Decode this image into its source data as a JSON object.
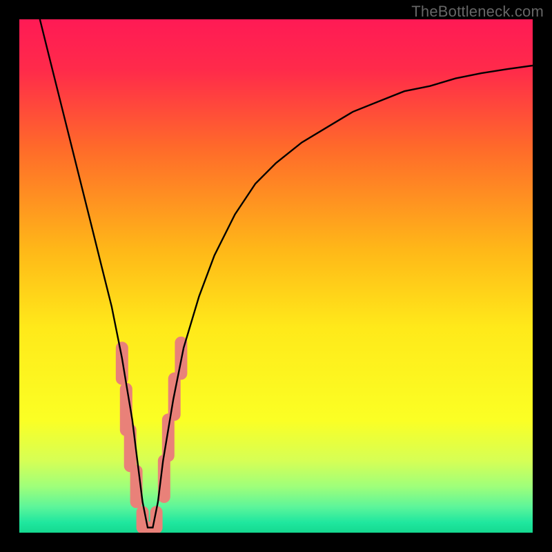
{
  "watermark": "TheBottleneck.com",
  "chart_data": {
    "type": "line",
    "title": "",
    "xlabel": "",
    "ylabel": "",
    "xlim": [
      0,
      100
    ],
    "ylim": [
      0,
      100
    ],
    "gradient_stops": [
      {
        "offset": 0.0,
        "color": "#ff1a55"
      },
      {
        "offset": 0.1,
        "color": "#ff2b4a"
      },
      {
        "offset": 0.25,
        "color": "#ff6a2a"
      },
      {
        "offset": 0.45,
        "color": "#ffb818"
      },
      {
        "offset": 0.6,
        "color": "#ffe91a"
      },
      {
        "offset": 0.78,
        "color": "#fbff24"
      },
      {
        "offset": 0.86,
        "color": "#d6ff55"
      },
      {
        "offset": 0.91,
        "color": "#9fff7a"
      },
      {
        "offset": 0.95,
        "color": "#5cf59a"
      },
      {
        "offset": 0.98,
        "color": "#1fe79f"
      },
      {
        "offset": 1.0,
        "color": "#15d98f"
      }
    ],
    "series": [
      {
        "name": "bottleneck-curve",
        "x": [
          4,
          6,
          8,
          10,
          12,
          14,
          16,
          18,
          20,
          21,
          22,
          23,
          24,
          25,
          26,
          27,
          28,
          30,
          32,
          35,
          38,
          42,
          46,
          50,
          55,
          60,
          65,
          70,
          75,
          80,
          85,
          90,
          95,
          100
        ],
        "y": [
          100,
          92,
          84,
          76,
          68,
          60,
          52,
          44,
          34,
          28,
          22,
          14,
          6,
          1,
          1,
          6,
          14,
          26,
          36,
          46,
          54,
          62,
          68,
          72,
          76,
          79,
          82,
          84,
          86,
          87,
          88.5,
          89.5,
          90.3,
          91
        ]
      }
    ],
    "markers": {
      "name": "highlighted-segments",
      "color": "#e98179",
      "points": [
        {
          "x": 20.0,
          "y_top": 36,
          "y_bot": 30
        },
        {
          "x": 20.8,
          "y_top": 28,
          "y_bot": 20
        },
        {
          "x": 21.6,
          "y_top": 20,
          "y_bot": 13
        },
        {
          "x": 22.8,
          "y_top": 12,
          "y_bot": 6
        },
        {
          "x": 24.0,
          "y_top": 4,
          "y_bot": 1
        },
        {
          "x": 25.5,
          "y_top": 1,
          "y_bot": 1
        },
        {
          "x": 26.7,
          "y_top": 4,
          "y_bot": 1
        },
        {
          "x": 28.2,
          "y_top": 14,
          "y_bot": 7
        },
        {
          "x": 29.0,
          "y_top": 22,
          "y_bot": 15
        },
        {
          "x": 30.2,
          "y_top": 30,
          "y_bot": 23
        },
        {
          "x": 31.5,
          "y_top": 37,
          "y_bot": 31
        }
      ]
    }
  }
}
